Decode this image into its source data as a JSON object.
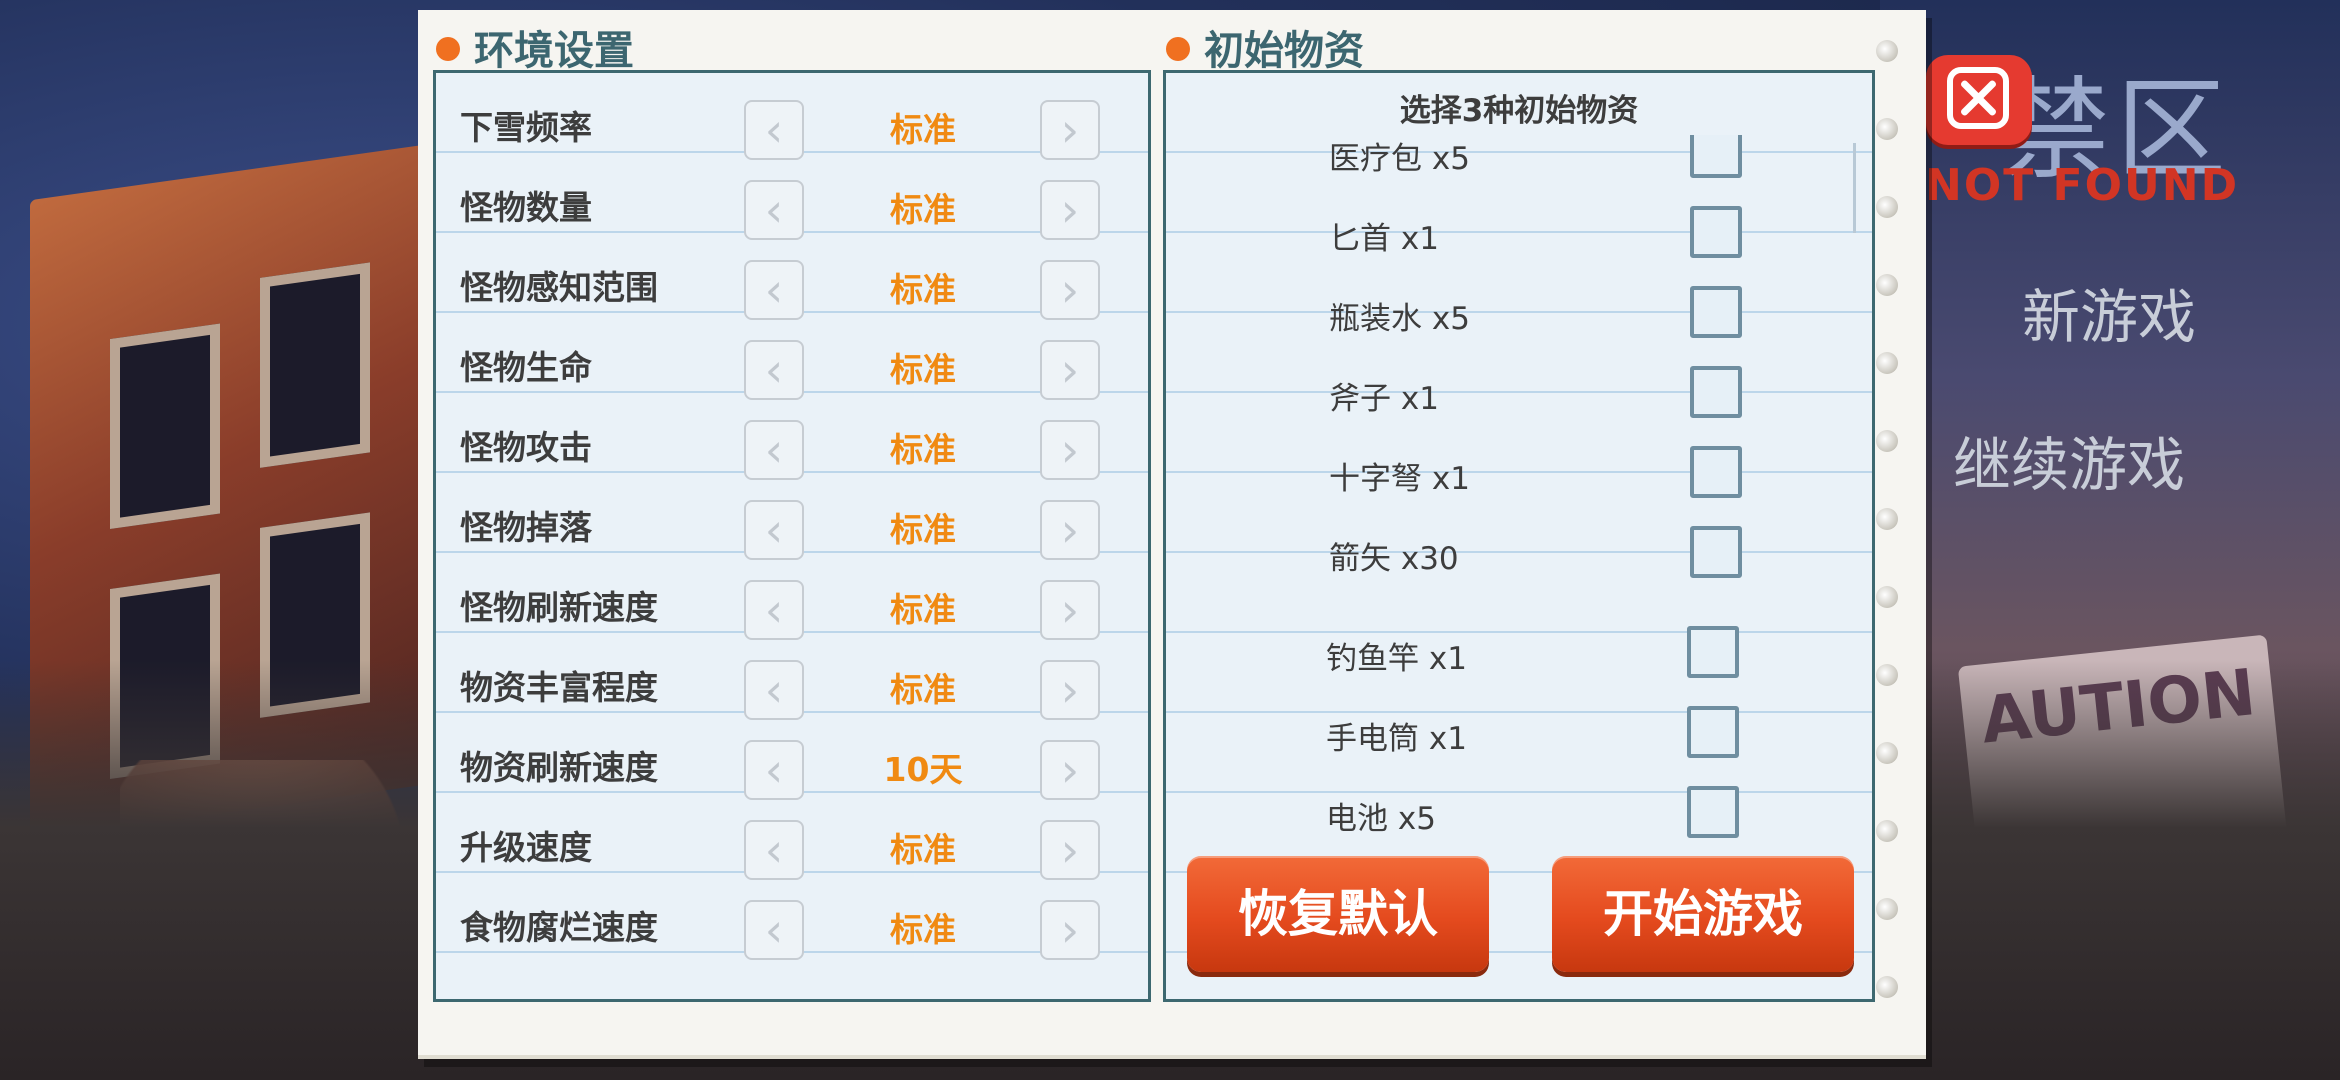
{
  "game": {
    "title_cn": "禁区",
    "title_en": "NOT FOUND"
  },
  "menu": {
    "new_game": "新游戏",
    "continue_game": "继续游戏"
  },
  "environment": {
    "heading": "环境设置",
    "settings": [
      {
        "label": "下雪频率",
        "value": "标准"
      },
      {
        "label": "怪物数量",
        "value": "标准"
      },
      {
        "label": "怪物感知范围",
        "value": "标准"
      },
      {
        "label": "怪物生命",
        "value": "标准"
      },
      {
        "label": "怪物攻击",
        "value": "标准"
      },
      {
        "label": "怪物掉落",
        "value": "标准"
      },
      {
        "label": "怪物刷新速度",
        "value": "标准"
      },
      {
        "label": "物资丰富程度",
        "value": "标准"
      },
      {
        "label": "物资刷新速度",
        "value": "10天"
      },
      {
        "label": "升级速度",
        "value": "标准"
      },
      {
        "label": "食物腐烂速度",
        "value": "标准"
      }
    ],
    "arrow_left_glyph": "‹",
    "arrow_right_glyph": "›"
  },
  "supplies": {
    "heading": "初始物资",
    "instruction": "选择3种初始物资",
    "items": [
      {
        "name": "医疗包 x5",
        "checked": false
      },
      {
        "name": "匕首 x1",
        "checked": false
      },
      {
        "name": "瓶装水 x5",
        "checked": false
      },
      {
        "name": "斧子 x1",
        "checked": false
      },
      {
        "name": "十字弩 x1",
        "checked": false
      },
      {
        "name": "箭矢 x30",
        "checked": false
      },
      {
        "name": "钓鱼竿 x1",
        "checked": false
      },
      {
        "name": "手电筒 x1",
        "checked": false
      },
      {
        "name": "电池 x5",
        "checked": false
      }
    ]
  },
  "buttons": {
    "reset": "恢复默认",
    "start": "开始游戏"
  },
  "colors": {
    "accent_orange": "#f08a12",
    "button_red": "#e44a1e",
    "heading_teal": "#3c6670"
  },
  "icons": {
    "close": "close-icon",
    "left": "chevron-left-icon",
    "right": "chevron-right-icon",
    "bullet": "orange-dot-icon"
  }
}
